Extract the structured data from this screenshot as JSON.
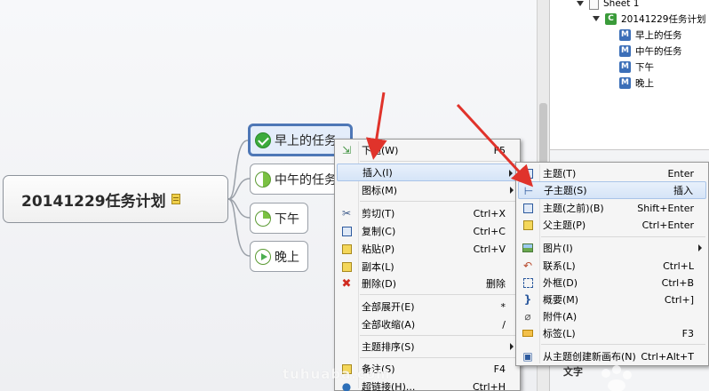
{
  "mindmap": {
    "central_topic": "20141229任务计划",
    "topics": [
      {
        "label": "早上的任务",
        "icon": "task-done-icon"
      },
      {
        "label": "中午的任务",
        "icon": "task-half-icon"
      },
      {
        "label": "下午",
        "icon": "task-quarter-icon"
      },
      {
        "label": "晚上",
        "icon": "task-start-icon"
      }
    ]
  },
  "outline": {
    "sheet": "Sheet 1",
    "root": "20141229任务计划",
    "root_badge": "C",
    "item_badge": "M",
    "items": [
      "早上的任务",
      "中午的任务",
      "下午",
      "晚上"
    ]
  },
  "props": {
    "section_label": "文字"
  },
  "context_menu": {
    "items": [
      {
        "label": "下题(W)",
        "shortcut": "F5"
      },
      {
        "label": "插入(I)",
        "shortcut": ""
      },
      {
        "label": "图标(M)",
        "shortcut": ""
      },
      {
        "label": "剪切(T)",
        "shortcut": "Ctrl+X"
      },
      {
        "label": "复制(C)",
        "shortcut": "Ctrl+C"
      },
      {
        "label": "粘贴(P)",
        "shortcut": "Ctrl+V"
      },
      {
        "label": "副本(L)",
        "shortcut": ""
      },
      {
        "label": "删除(D)",
        "shortcut": "删除"
      },
      {
        "label": "全部展开(E)",
        "shortcut": "*"
      },
      {
        "label": "全部收缩(A)",
        "shortcut": "/"
      },
      {
        "label": "主题排序(S)",
        "shortcut": ""
      },
      {
        "label": "备注(S)",
        "shortcut": "F4"
      },
      {
        "label": "超链接(H)...",
        "shortcut": "Ctrl+H"
      }
    ]
  },
  "insert_submenu": {
    "items": [
      {
        "label": "主题(T)",
        "shortcut": "Enter"
      },
      {
        "label": "子主题(S)",
        "shortcut": "插入"
      },
      {
        "label": "主题(之前)(B)",
        "shortcut": "Shift+Enter"
      },
      {
        "label": "父主题(P)",
        "shortcut": "Ctrl+Enter"
      },
      {
        "label": "图片(I)",
        "shortcut": ""
      },
      {
        "label": "联系(L)",
        "shortcut": "Ctrl+L"
      },
      {
        "label": "外框(D)",
        "shortcut": "Ctrl+B"
      },
      {
        "label": "概要(M)",
        "shortcut": "Ctrl+]"
      },
      {
        "label": "附件(A)",
        "shortcut": ""
      },
      {
        "label": "标签(L)",
        "shortcut": "F3"
      },
      {
        "label": "从主题创建新画布(N)",
        "shortcut": "Ctrl+Alt+T"
      }
    ]
  },
  "watermark": "tuhuaba.com",
  "colors": {
    "selection_border": "#4e77b6",
    "annotation_arrow": "#e0332b",
    "menu_highlight": "#d5e4f7"
  }
}
